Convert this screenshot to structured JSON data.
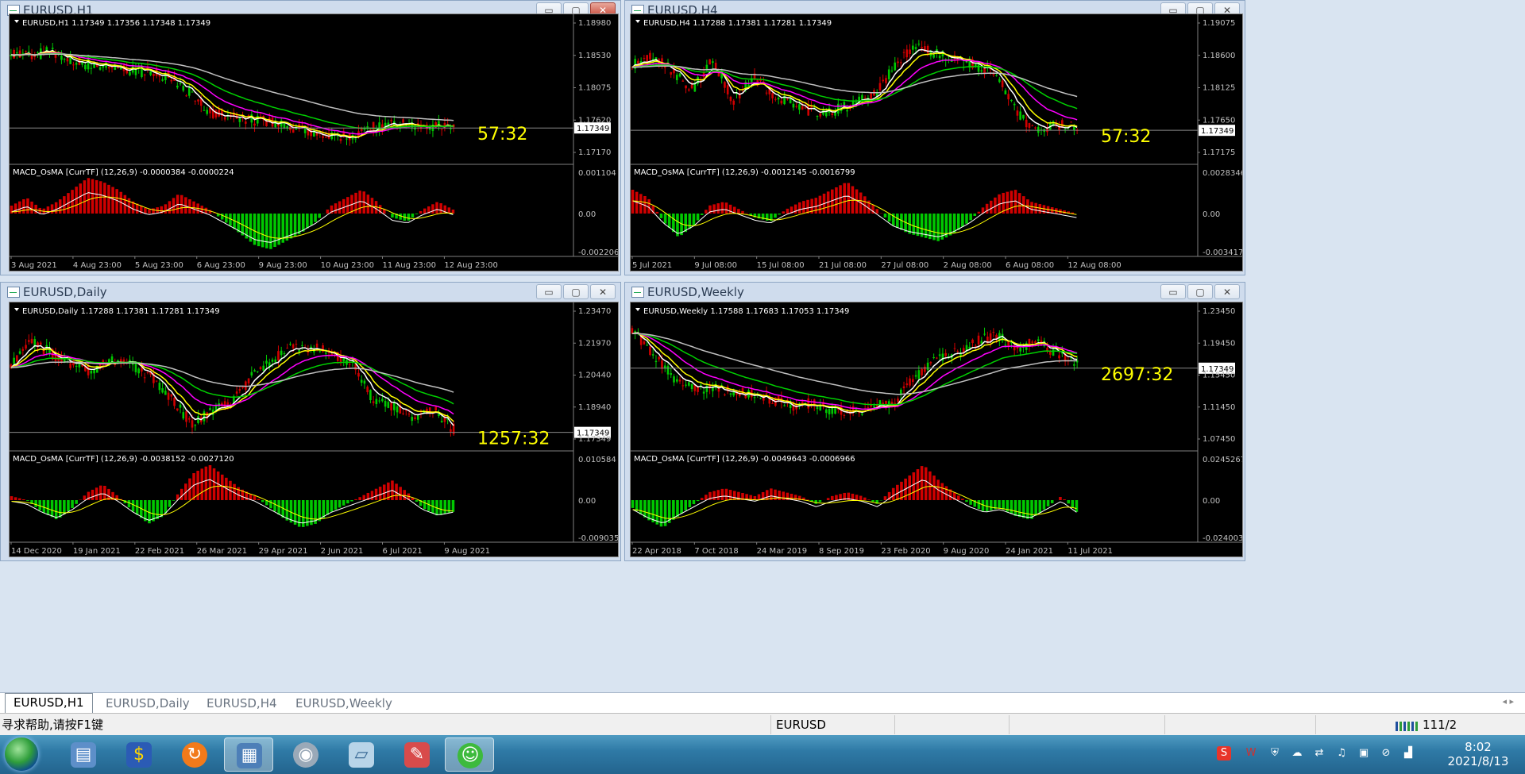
{
  "windows": [
    {
      "title": "EURUSD,H1",
      "price_label": "EURUSD,H1  1.17349 1.17356 1.17348 1.17349",
      "price_axis": [
        "1.18980",
        "1.18530",
        "1.18075",
        "1.17620",
        "1.17170"
      ],
      "current_price": "1.17349",
      "timer": "57:32",
      "macd_label": "MACD_OsMA [CurrTF] (12,26,9) -0.0000384 -0.0000224",
      "macd_axis": [
        "0.001104",
        "0.00",
        "-0.002206"
      ],
      "dates": [
        "3 Aug 2021",
        "4 Aug 23:00",
        "5 Aug 23:00",
        "6 Aug 23:00",
        "9 Aug 23:00",
        "10 Aug 23:00",
        "11 Aug 23:00",
        "12 Aug 23:00"
      ]
    },
    {
      "title": "EURUSD,H4",
      "price_label": "EURUSD,H4  1.17288 1.17381 1.17281 1.17349",
      "price_axis": [
        "1.19075",
        "1.18600",
        "1.18125",
        "1.17650",
        "1.17175"
      ],
      "current_price": "1.17349",
      "timer": "57:32",
      "macd_label": "MACD_OsMA [CurrTF] (12,26,9) -0.0012145 -0.0016799",
      "macd_axis": [
        "0.0028346",
        "0.00",
        "-0.0034177"
      ],
      "dates": [
        "5 Jul 2021",
        "9 Jul 08:00",
        "15 Jul 08:00",
        "21 Jul 08:00",
        "27 Jul 08:00",
        "2 Aug 08:00",
        "6 Aug 08:00",
        "12 Aug 08:00"
      ]
    },
    {
      "title": "EURUSD,Daily",
      "price_label": "EURUSD,Daily  1.17288 1.17381 1.17281 1.17349",
      "price_axis": [
        "1.23470",
        "1.21970",
        "1.20440",
        "1.18940",
        "1.17349"
      ],
      "current_price": "1.17349",
      "timer": "1257:32",
      "macd_label": "MACD_OsMA [CurrTF] (12,26,9) -0.0038152 -0.0027120",
      "macd_axis": [
        "0.010584",
        "0.00",
        "-0.009035"
      ],
      "dates": [
        "14 Dec 2020",
        "19 Jan 2021",
        "22 Feb 2021",
        "26 Mar 2021",
        "29 Apr 2021",
        "2 Jun 2021",
        "6 Jul 2021",
        "9 Aug 2021"
      ]
    },
    {
      "title": "EURUSD,Weekly",
      "price_label": "EURUSD,Weekly  1.17588 1.17683 1.17053 1.17349",
      "price_axis": [
        "1.23450",
        "1.19450",
        "1.15450",
        "1.11450",
        "1.07450"
      ],
      "current_price": "1.17349",
      "timer": "2697:32",
      "macd_label": "MACD_OsMA [CurrTF] (12,26,9) -0.0049643 -0.0006966",
      "macd_axis": [
        "0.0245267",
        "0.00",
        "-0.024003"
      ],
      "dates": [
        "22 Apr 2018",
        "7 Oct 2018",
        "24 Mar 2019",
        "8 Sep 2019",
        "23 Feb 2020",
        "9 Aug 2020",
        "24 Jan 2021",
        "11 Jul 2021"
      ]
    }
  ],
  "window_buttons": {
    "minimize": "▭",
    "maximize": "▢",
    "close": "✕"
  },
  "tabs": [
    "EURUSD,H1",
    "EURUSD,Daily",
    "EURUSD,H4",
    "EURUSD,Weekly"
  ],
  "tabs_nav": "◂ ▸",
  "status": {
    "help": "寻求帮助,请按F1键",
    "symbol": "EURUSD",
    "traffic": "111/2 kb"
  },
  "taskbar": {
    "time": "8:02",
    "date": "2021/8/13"
  },
  "colors": {
    "bull": "#00c800",
    "bear": "#d00000",
    "ma_fast": "#ffffff",
    "ma_yellow": "#ffff00",
    "ma_magenta": "#ff00ff",
    "ma_green": "#00d000",
    "ma_gray": "#c0c0c0",
    "timer": "#ffff00"
  }
}
